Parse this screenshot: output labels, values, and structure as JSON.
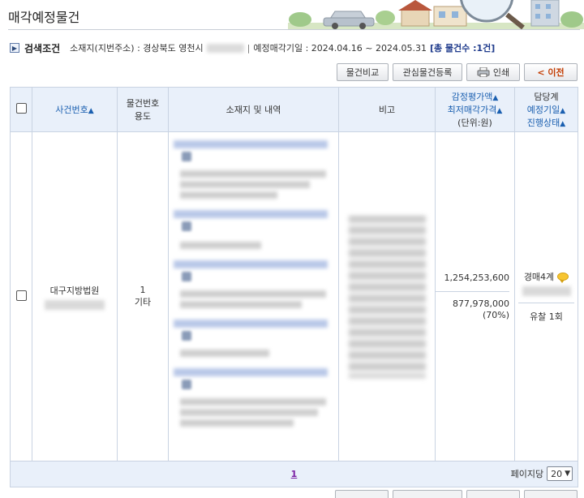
{
  "page": {
    "title": "매각예정물건"
  },
  "search_conditions": {
    "label": "검색조건",
    "location_label": "소재지(지번주소) : 경상북도 영천시",
    "separator": "|",
    "period_label": "예정매각기일 : 2024.04.16 ~ 2024.05.31",
    "total_label": "[총 물건수 :1건]"
  },
  "toolbar": {
    "compare_label": "물건비교",
    "watch_label": "관심물건등록",
    "print_label": "인쇄",
    "prev_label": "< 이전"
  },
  "table": {
    "headers": {
      "case_no": "사건번호",
      "item_no_line1": "물건번호",
      "item_no_line2": "용도",
      "location": "소재지 및 내역",
      "remarks": "비고",
      "price_line1": "감정평가액",
      "price_line2": "최저매각가격",
      "price_line3": "(단위:원)",
      "status_line1": "담당계",
      "status_line2": "예정기일",
      "status_line3": "진행상태"
    },
    "sort_arrow": "▲",
    "rows": [
      {
        "court": "대구지방법원",
        "item_no": "1",
        "usage": "기타",
        "appraisal_price": "1,254,253,600",
        "min_price": "877,978,000",
        "min_price_ratio": "(70%)",
        "department": "경매4계",
        "status": "유찰 1회"
      }
    ]
  },
  "pagination": {
    "current_page": "1",
    "per_page_label": "페이지당",
    "per_page_value": "20"
  },
  "colors": {
    "header_bg": "#e9f0fa",
    "link_blue": "#1a5fb0",
    "prev_orange": "#c23b00",
    "pager_purple": "#7a1fa3"
  }
}
